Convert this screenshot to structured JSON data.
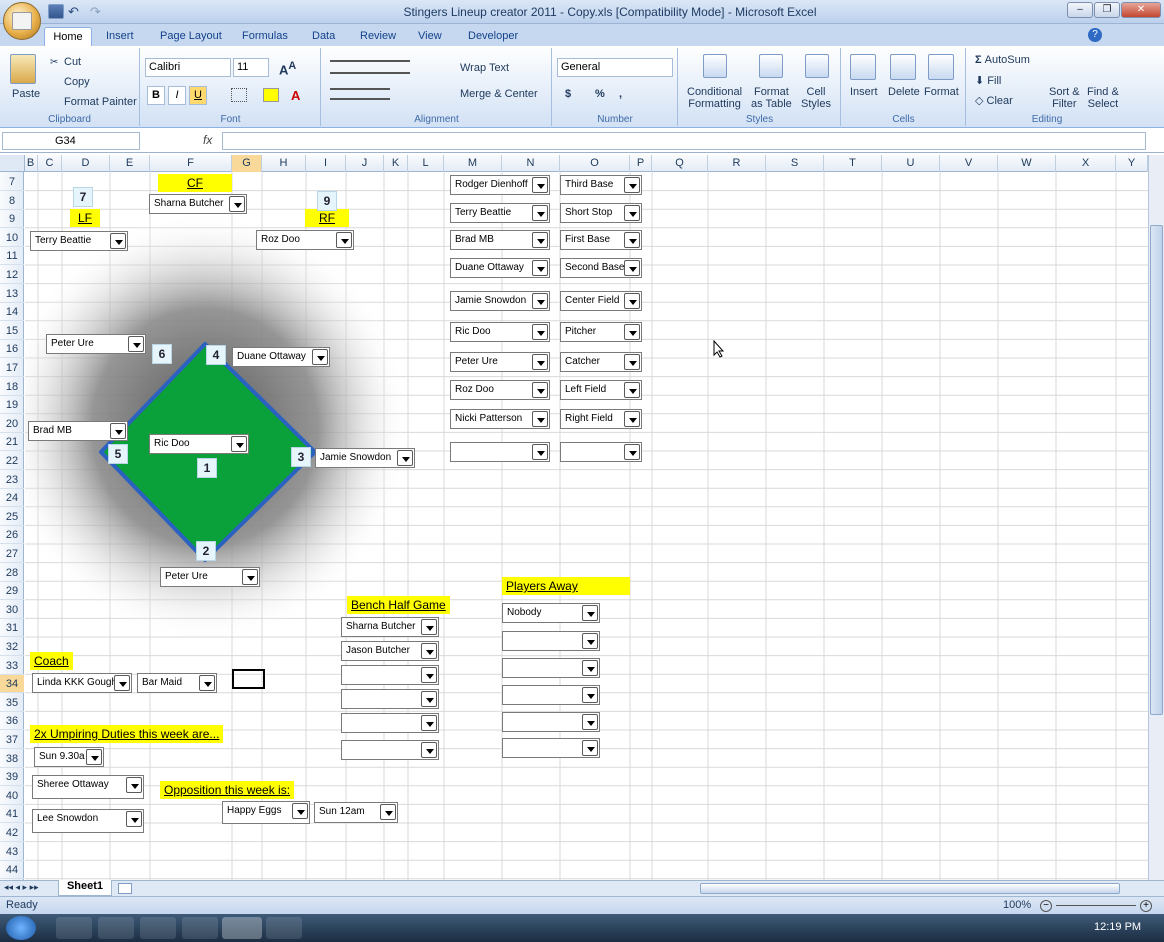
{
  "window": {
    "title": "Stingers Lineup creator 2011 - Copy.xls  [Compatibility Mode] - Microsoft Excel"
  },
  "tabs": [
    "Home",
    "Insert",
    "Page Layout",
    "Formulas",
    "Data",
    "Review",
    "View",
    "Developer"
  ],
  "ribbon": {
    "clipboard": {
      "paste": "Paste",
      "cut": "Cut",
      "copy": "Copy",
      "format_painter": "Format Painter",
      "label": "Clipboard"
    },
    "font": {
      "name": "Calibri",
      "size": "11",
      "label": "Font",
      "bold": "B",
      "italic": "I",
      "underline": "U"
    },
    "alignment": {
      "wrap": "Wrap Text",
      "merge": "Merge & Center",
      "label": "Alignment"
    },
    "number": {
      "format": "General",
      "label": "Number",
      "currency": "$",
      "percent": "%",
      "comma": ","
    },
    "styles": {
      "conditional_1": "Conditional",
      "conditional_2": "Formatting",
      "format_table_1": "Format",
      "format_table_2": "as Table",
      "cell_styles_1": "Cell",
      "cell_styles_2": "Styles",
      "label": "Styles"
    },
    "cells": {
      "insert": "Insert",
      "delete": "Delete",
      "format": "Format",
      "label": "Cells"
    },
    "editing": {
      "autosum": "AutoSum",
      "fill": "Fill",
      "clear": "Clear",
      "sort_1": "Sort &",
      "sort_2": "Filter",
      "find_1": "Find &",
      "find_2": "Select",
      "label": "Editing"
    }
  },
  "formula_bar": {
    "name_box": "G34",
    "fx": "fx",
    "formula": ""
  },
  "columns": [
    "B",
    "C",
    "D",
    "E",
    "F",
    "G",
    "H",
    "I",
    "J",
    "K",
    "L",
    "M",
    "N",
    "O",
    "P",
    "Q",
    "R",
    "S",
    "T",
    "U",
    "V",
    "W",
    "X",
    "Y"
  ],
  "rows": [
    "7",
    "8",
    "9",
    "10",
    "11",
    "12",
    "13",
    "14",
    "15",
    "16",
    "17",
    "18",
    "19",
    "20",
    "21",
    "22",
    "23",
    "24",
    "25",
    "26",
    "27",
    "28",
    "29",
    "30",
    "31",
    "32",
    "33",
    "34",
    "35",
    "36",
    "37",
    "38",
    "39",
    "40",
    "41",
    "42",
    "43",
    "44"
  ],
  "sheet": {
    "field_labels": {
      "cf": "CF",
      "lf": "LF",
      "rf": "RF"
    },
    "position_numbers": {
      "lf": "7",
      "rf": "9",
      "p6": "6",
      "p4": "4",
      "p5": "5",
      "p3": "3",
      "p1": "1",
      "p2": "2"
    },
    "field_players": {
      "cf": "Sharna Butcher",
      "lf": "Terry Beattie",
      "rf": "Roz Doo",
      "ss": "Peter Ure",
      "second": "Duane Ottaway",
      "third": "Brad MB",
      "pitcher": "Ric Doo",
      "first": "Jamie Snowdon",
      "catcher": "Peter Ure"
    },
    "roster": [
      {
        "player": "Rodger Dienhoff",
        "position": "Third Base"
      },
      {
        "player": "Terry Beattie",
        "position": "Short Stop"
      },
      {
        "player": "Brad MB",
        "position": "First Base"
      },
      {
        "player": "Duane Ottaway",
        "position": "Second Base"
      },
      {
        "player": "Jamie Snowdon",
        "position": "Center Field"
      },
      {
        "player": "Ric Doo",
        "position": "Pitcher"
      },
      {
        "player": "Peter Ure",
        "position": "Catcher"
      },
      {
        "player": "Roz Doo",
        "position": "Left Field"
      },
      {
        "player": "Nicki Patterson",
        "position": "Right Field"
      },
      {
        "player": "",
        "position": ""
      }
    ],
    "players_away_label": "Players Away",
    "players_away": [
      "Nobody",
      "",
      "",
      "",
      "",
      ""
    ],
    "bench_label": "Bench Half Game",
    "bench": [
      "Sharna Butcher",
      "Jason Butcher",
      "",
      "",
      "",
      ""
    ],
    "coach_label": "Coach",
    "coach": "Linda KKK Gough",
    "coach2": "Bar Maid",
    "umpiring_label": "2x Umpiring Duties this week are...",
    "umpiring_time": "Sun 9.30a",
    "umpires": [
      "Sheree Ottaway",
      "Lee Snowdon"
    ],
    "opposition_label": "Opposition this week is:",
    "opposition": "Happy Eggs",
    "opposition_time": "Sun 12am"
  },
  "sheet_tab": "Sheet1",
  "status": {
    "ready": "Ready",
    "zoom": "100%"
  },
  "taskbar": {
    "time": "12:19 PM"
  },
  "colors": {
    "field": "#0aa03a",
    "highlight": "#ffff00",
    "ribbon": "#dfeaf8"
  }
}
